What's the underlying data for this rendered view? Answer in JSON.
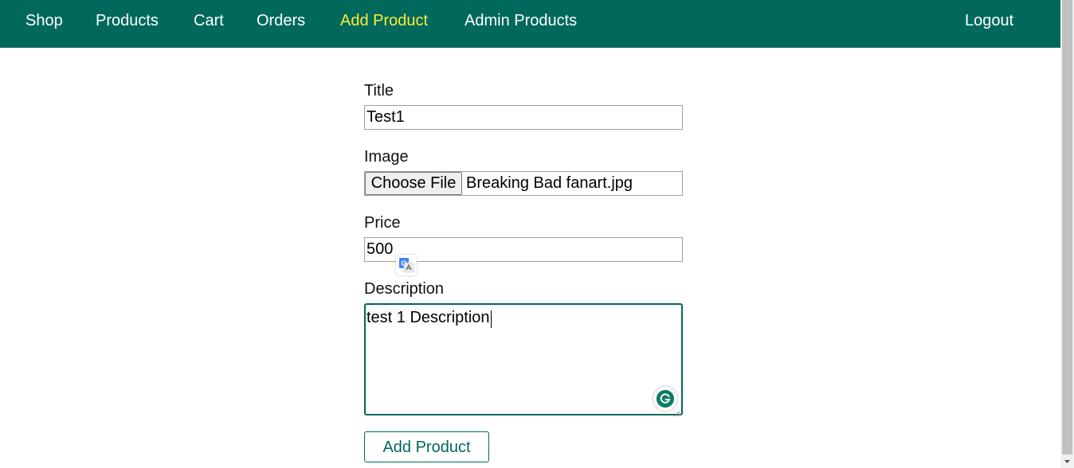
{
  "nav": {
    "items": [
      {
        "label": "Shop"
      },
      {
        "label": "Products"
      },
      {
        "label": "Cart"
      },
      {
        "label": "Orders"
      },
      {
        "label": "Add Product",
        "active": true
      },
      {
        "label": "Admin Products"
      }
    ],
    "logout_label": "Logout"
  },
  "form": {
    "title": {
      "label": "Title",
      "value": "Test1"
    },
    "image": {
      "label": "Image",
      "button_label": "Choose File",
      "file_name": "Breaking Bad fanart.jpg"
    },
    "price": {
      "label": "Price",
      "value": "500"
    },
    "description": {
      "label": "Description",
      "value": "test 1 Description"
    },
    "submit_label": "Add Product"
  },
  "colors": {
    "header_bg": "#00695c",
    "nav_text": "#ffffff",
    "nav_active": "#ffeb3b",
    "accent": "#00695c"
  },
  "icons": {
    "translate": "google-translate-icon",
    "grammarly": "grammarly-icon"
  }
}
